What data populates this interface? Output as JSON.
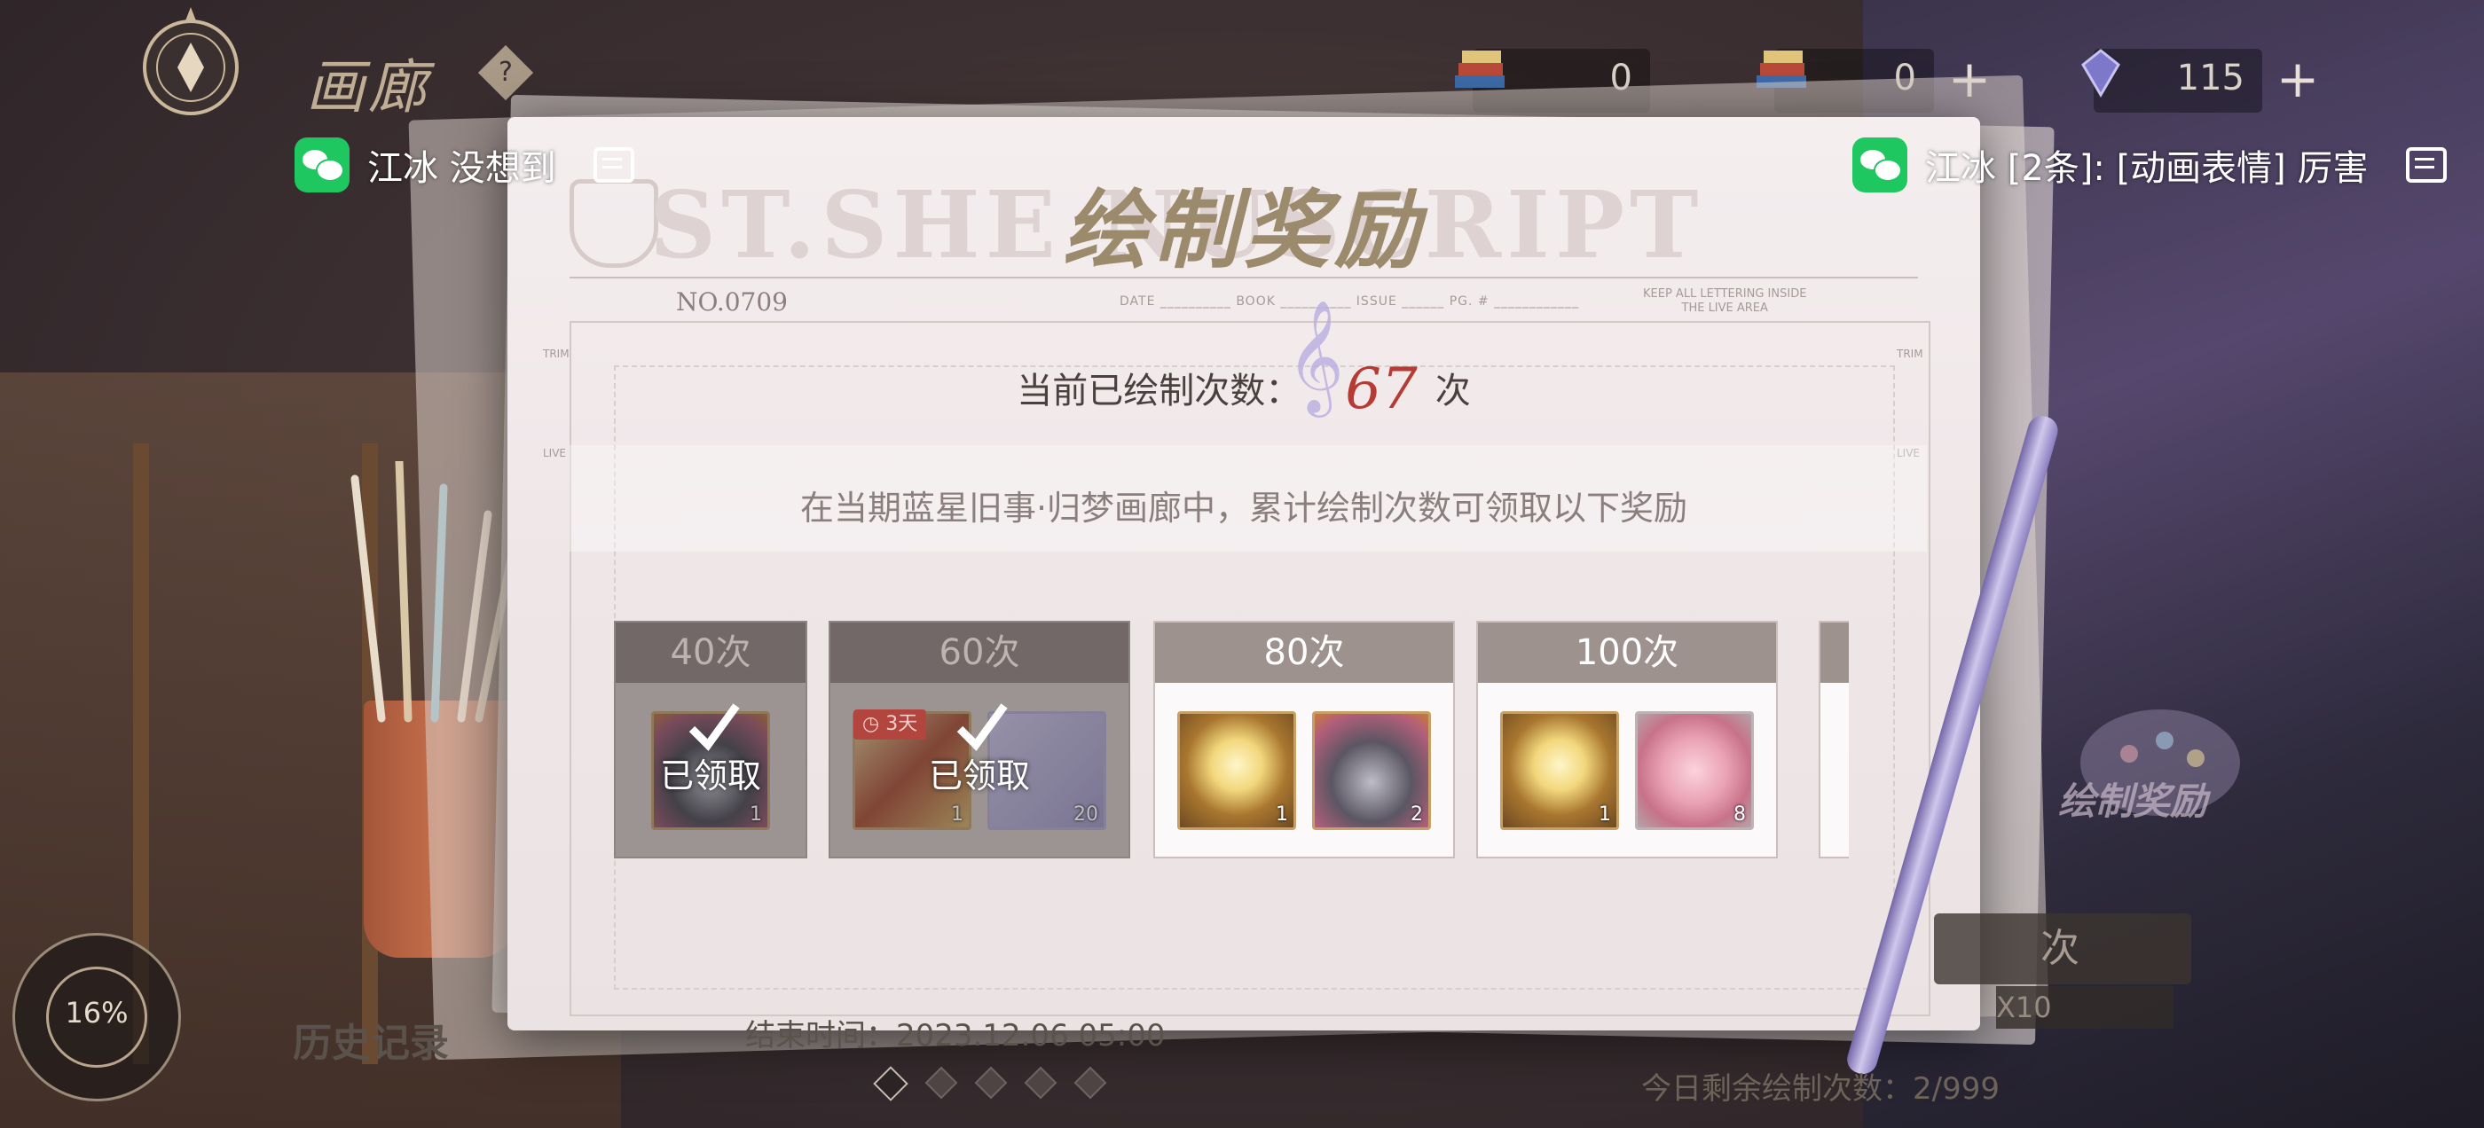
{
  "header": {
    "gallery_title": "画廊",
    "help_symbol": "?",
    "currencies": [
      {
        "icon": "book-stack-icon",
        "value": "0"
      },
      {
        "icon": "book-stack-icon",
        "value": "0"
      },
      {
        "icon": "crystal-icon",
        "value": "115"
      }
    ],
    "plus_symbol": "+"
  },
  "notifications": [
    {
      "icon": "wechat-icon",
      "text": "江冰 没想到"
    },
    {
      "icon": "wechat-icon",
      "text": "江冰 [2条]: [动画表情] 厉害"
    }
  ],
  "panel": {
    "watermark": "ST.SHE          NUSCRIPT",
    "title": "绘制奖励",
    "form_no": "NO.0709",
    "form_fields": "DATE __________  BOOK __________  ISSUE ______  PG. # ____________",
    "keep_note_line1": "KEEP ALL LETTERING INSIDE",
    "keep_note_line2": "THE LIVE AREA",
    "trim_label": "TRIM",
    "live_label": "LIVE",
    "count_label": "当前已绘制次数：",
    "count_value": "67",
    "count_unit": "次",
    "description": "在当期蓝星旧事·归梦画廊中，累计绘制次数可领取以下奖励"
  },
  "rewards": [
    {
      "threshold": "40次",
      "claimed": true,
      "claimed_label": "已领取",
      "items": [
        {
          "kind": "avatar-frame",
          "qty": "1"
        }
      ]
    },
    {
      "threshold": "60次",
      "claimed": true,
      "claimed_label": "已领取",
      "timer": "3天",
      "items": [
        {
          "kind": "paint-set",
          "qty": "1"
        },
        {
          "kind": "butterfly",
          "qty": "20"
        }
      ]
    },
    {
      "threshold": "80次",
      "claimed": false,
      "items": [
        {
          "kind": "gold-gift-box",
          "qty": "1"
        },
        {
          "kind": "avatar-frame",
          "qty": "2"
        }
      ]
    },
    {
      "threshold": "100次",
      "claimed": false,
      "items": [
        {
          "kind": "gold-gift-box",
          "qty": "1"
        },
        {
          "kind": "pink-gift-box",
          "qty": "8"
        }
      ]
    }
  ],
  "background": {
    "feature_label": "绘制奖励",
    "draw_button": "次",
    "draw_x10": "X10",
    "daily_remaining": "今日剩余绘制次数：2/999",
    "history_label": "历史记录",
    "end_time": "结束时间：2023.12.06 05:00",
    "progress": "16%",
    "page_count": 5,
    "active_page": 1
  },
  "colors": {
    "accent_red": "#b63b34",
    "title_gold": "#9b8a6b",
    "wechat_green": "#1ec760",
    "card_header": "#9e928f"
  }
}
